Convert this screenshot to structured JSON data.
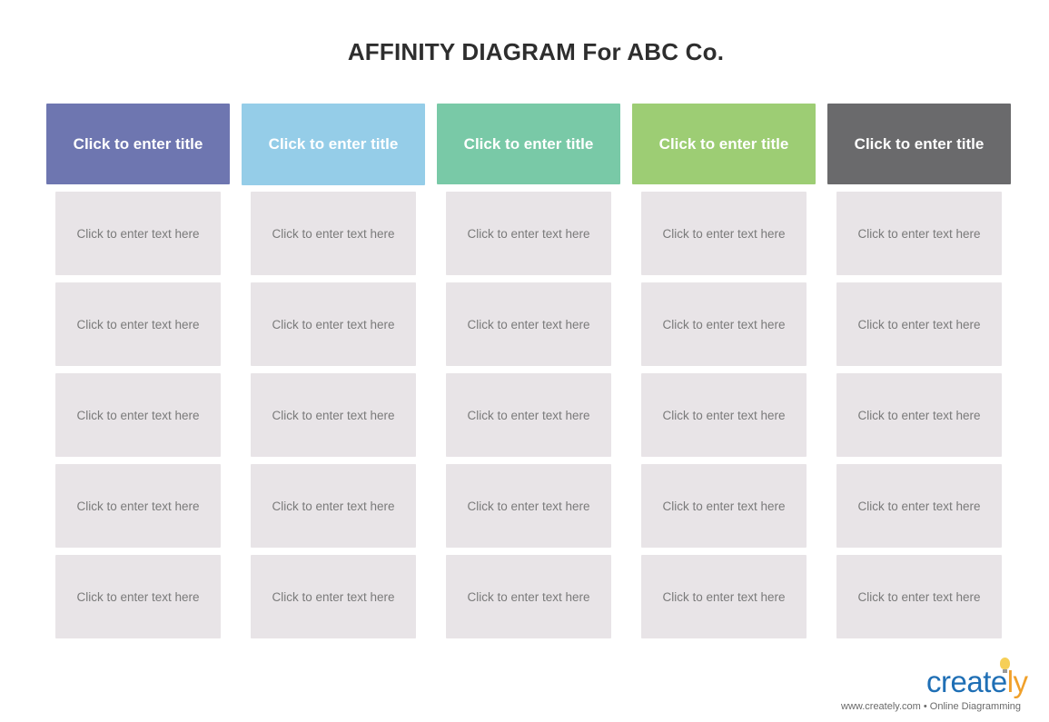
{
  "title": "AFFINITY DIAGRAM For ABC Co.",
  "columns": [
    {
      "header": "Click to enter title",
      "color": "#6e76b0",
      "cards": [
        "Click to enter text here",
        "Click to enter text here",
        "Click to enter text here",
        "Click to enter text here",
        "Click to enter text here"
      ]
    },
    {
      "header": "Click to enter title",
      "color": "#95cde8",
      "cards": [
        "Click to enter text here",
        "Click to enter text here",
        "Click to enter text here",
        "Click to enter text here",
        "Click to enter text here"
      ]
    },
    {
      "header": "Click to enter title",
      "color": "#79c9a7",
      "cards": [
        "Click to enter text here",
        "Click to enter text here",
        "Click to enter text here",
        "Click to enter text here",
        "Click to enter text here"
      ]
    },
    {
      "header": "Click to enter title",
      "color": "#9dcd74",
      "cards": [
        "Click to enter text here",
        "Click to enter text here",
        "Click to enter text here",
        "Click to enter text here",
        "Click to enter text here"
      ]
    },
    {
      "header": "Click to enter title",
      "color": "#6a6a6c",
      "cards": [
        "Click to enter text here",
        "Click to enter text here",
        "Click to enter text here",
        "Click to enter text here",
        "Click to enter text here"
      ]
    }
  ],
  "branding": {
    "logo_main": "create",
    "logo_accent": "ly",
    "tagline": "www.creately.com • Online Diagramming"
  }
}
